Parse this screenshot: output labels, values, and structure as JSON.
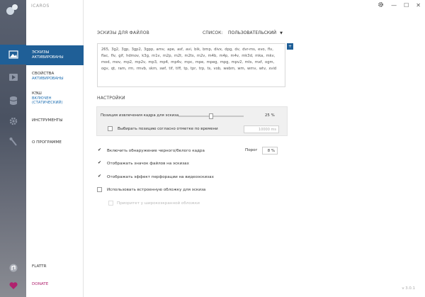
{
  "app": {
    "title": "ICAROS",
    "version": "v 3.0.1"
  },
  "topbar": {
    "settings_icon": "gear-icon",
    "minimize": "—",
    "maximize": "☐",
    "close": "✕"
  },
  "rail": {
    "icons": [
      "image-icon",
      "play-icon",
      "database-icon",
      "gear-icon",
      "tools-icon",
      "flattr-icon",
      "heart-icon"
    ]
  },
  "nav": {
    "thumbnails": {
      "title": "ЭСКИЗЫ",
      "status": "АКТИВИРОВАНЫ"
    },
    "properties": {
      "title": "СВОЙСТВА",
      "status": "АКТИВИРОВАНЫ"
    },
    "cache": {
      "title": "КЭШ",
      "status_line1": "ВКЛЮЧЕН",
      "status_line2": "(СТАТИЧЕСКИЙ)"
    },
    "tools": {
      "title": "ИНСТРУМЕНТЫ"
    },
    "about": {
      "title": "О ПРОГРАММЕ"
    },
    "flattr": {
      "title": "FLATTR"
    },
    "donate": {
      "title": "DONATE"
    }
  },
  "main": {
    "section_files": "ЭСКИЗЫ ДЛЯ ФАЙЛОВ",
    "list_label": "СПИСОК:",
    "list_value": "ПОЛЬЗОВАТЕЛЬСКИЙ",
    "extensions": "265, 3g2, 3gp, 3gp2, 3gpp, amv, ape, asf, avi, bik, bmp, divx, dpg, dv, dvr-ms, evo, flv, flac, flv, gif, hdmov, k3g, m1v, m2p, m2t, m2ts, m2v, m4b, m4p, m4v, mk3d, mka, mkv, mod, mov, mp2, mp2v, mp3, mp4, mp4v, mpc, mpe, mpeg, mpg, mpv2, mts, mxf, ogm, ogv, qt, ram, rm, rmvb, skm, swf, tif, tiff, tp, tpr, trp, ts, vob, webm, wm, wmv, wtv, xvid",
    "section_settings": "НАСТРОЙКИ",
    "frame_position_label": "Позиция извлечения кадра для эскиза",
    "frame_position_value": "25 %",
    "frame_position_fraction": 0.25,
    "timestamp_label": "Выбирать позицию согласно отметке по времени",
    "timestamp_value": "10000 ms",
    "options": [
      {
        "label": "Включить обнаружение черного/белого кадра",
        "checked": true,
        "disabled": false
      },
      {
        "label": "Отображать значок файлов на эскизах",
        "checked": true,
        "disabled": false
      },
      {
        "label": "Отображать эффект перфорации на видеоэскизах",
        "checked": true,
        "disabled": false
      },
      {
        "label": "Использовать встроенную обложку для эскиза",
        "checked": false,
        "disabled": false
      },
      {
        "label": "Приоритет у широкоэкранной обложки",
        "checked": false,
        "disabled": true
      }
    ],
    "threshold_label": "Порог",
    "threshold_value": "8 %"
  }
}
